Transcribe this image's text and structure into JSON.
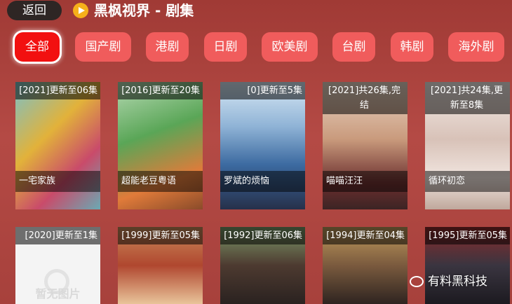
{
  "header": {
    "back_label": "返回",
    "title": "黑枫视界 - 剧集",
    "logo_icon": "play-icon"
  },
  "tabs": [
    {
      "label": "全部",
      "active": true
    },
    {
      "label": "国产剧",
      "active": false
    },
    {
      "label": "港剧",
      "active": false
    },
    {
      "label": "日剧",
      "active": false
    },
    {
      "label": "欧美剧",
      "active": false
    },
    {
      "label": "台剧",
      "active": false
    },
    {
      "label": "韩剧",
      "active": false
    },
    {
      "label": "海外剧",
      "active": false
    }
  ],
  "cards": [
    {
      "badge": "[2021]更新至06集",
      "name": "一宅家族",
      "bg": "#6aa9b3"
    },
    {
      "badge": "[2016]更新至20集",
      "name": "超能老豆粤语",
      "bg": "#5aa657"
    },
    {
      "badge": "[0]更新至5集",
      "name": "罗斌的烦恼",
      "bg": "#3c6aa0"
    },
    {
      "badge": "[2021]共26集,完结",
      "name": "喵喵汪汪",
      "bg": "#c99a7c"
    },
    {
      "badge": "[2021]共24集,更新至8集",
      "name": "循环初恋",
      "bg": "#d8c2b8"
    },
    {
      "badge": "[2020]更新至1集",
      "name": "",
      "bg": "#f2f2f2",
      "placeholder": "暂无图片"
    },
    {
      "badge": "[1999]更新至05集",
      "name": "",
      "bg": "#b0472f"
    },
    {
      "badge": "[1992]更新至06集",
      "name": "",
      "bg": "#4d3a30"
    },
    {
      "badge": "[1994]更新至04集",
      "name": "",
      "bg": "#7a5a3e"
    },
    {
      "badge": "[1995]更新至05集",
      "name": "",
      "bg": "#3a3540"
    }
  ],
  "watermark": {
    "text": "有料黑科技",
    "icon": "wechat-icon"
  }
}
